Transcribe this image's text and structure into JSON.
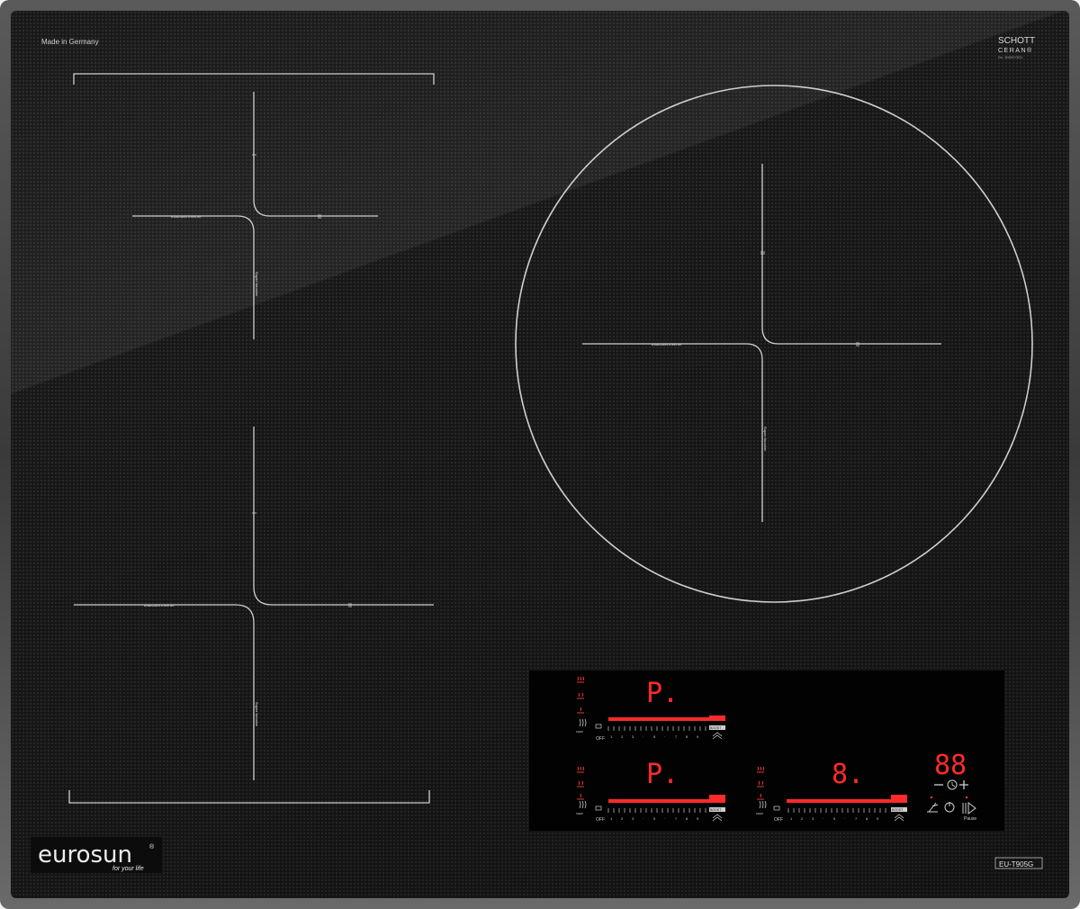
{
  "top_left_text": "Made in Germany",
  "schott": {
    "brand": "SCHOTT",
    "line2": "CERAN®",
    "small": "No. 800007831"
  },
  "zone_labels": {
    "inverter": "Induction Inverter",
    "booster": "Super booster"
  },
  "display": {
    "zone1": "P.",
    "zone2": "P.",
    "zone3": "8.",
    "timer": "88",
    "off_label": "OFF",
    "boost_label": "BOOST",
    "pause_label": "Pause",
    "keep_warm_label": "KEEP"
  },
  "scale_numbers": [
    "1",
    "2",
    "3",
    "·",
    "5",
    "·",
    "7",
    "8",
    "9"
  ],
  "brand": {
    "name": "eurosun",
    "reg": "®",
    "tagline": "for your life"
  },
  "model": "EU-T905G",
  "colors": {
    "display_red": "#ff2a2a",
    "glass": "#181818",
    "frame": "#4a4a4a"
  }
}
